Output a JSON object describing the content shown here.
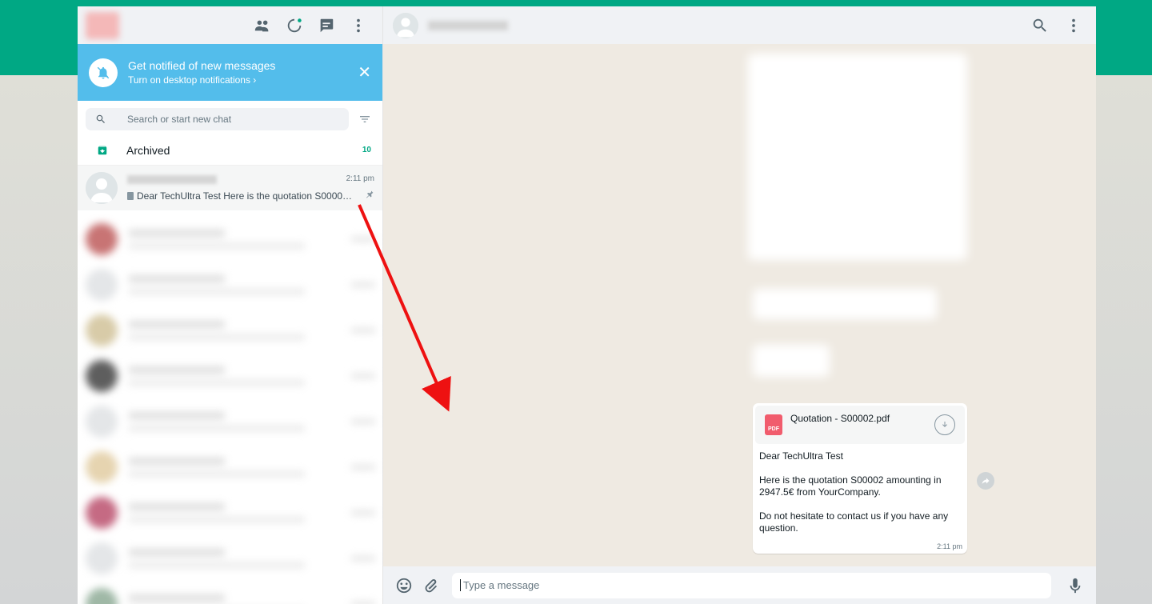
{
  "left_header": {
    "icons": [
      "community-icon",
      "status-icon",
      "new-chat-icon",
      "menu-icon"
    ]
  },
  "notification": {
    "title": "Get notified of new messages",
    "subtitle": "Turn on desktop notifications ›"
  },
  "search": {
    "placeholder": "Search or start new chat"
  },
  "archived": {
    "label": "Archived",
    "count": "10"
  },
  "active_chat": {
    "time": "2:11 pm",
    "preview": "Dear TechUltra Test Here is the quotation S00002 amounting in 2947.5€ from YourCompany."
  },
  "message": {
    "file_name": "Quotation - S00002.pdf",
    "file_badge": "PDF",
    "line1": "Dear TechUltra Test",
    "line2": "Here is the quotation S00002 amounting in 2947.5€ from YourCompany.",
    "line3": "Do not hesitate to contact us if you have any question.",
    "time": "2:11 pm"
  },
  "composer": {
    "placeholder": "Type a message"
  },
  "colors": {
    "brand": "#00a884",
    "notification_bg": "#53bdeb",
    "pdf_red": "#f15c6d",
    "annotation_arrow": "#ee1111"
  }
}
